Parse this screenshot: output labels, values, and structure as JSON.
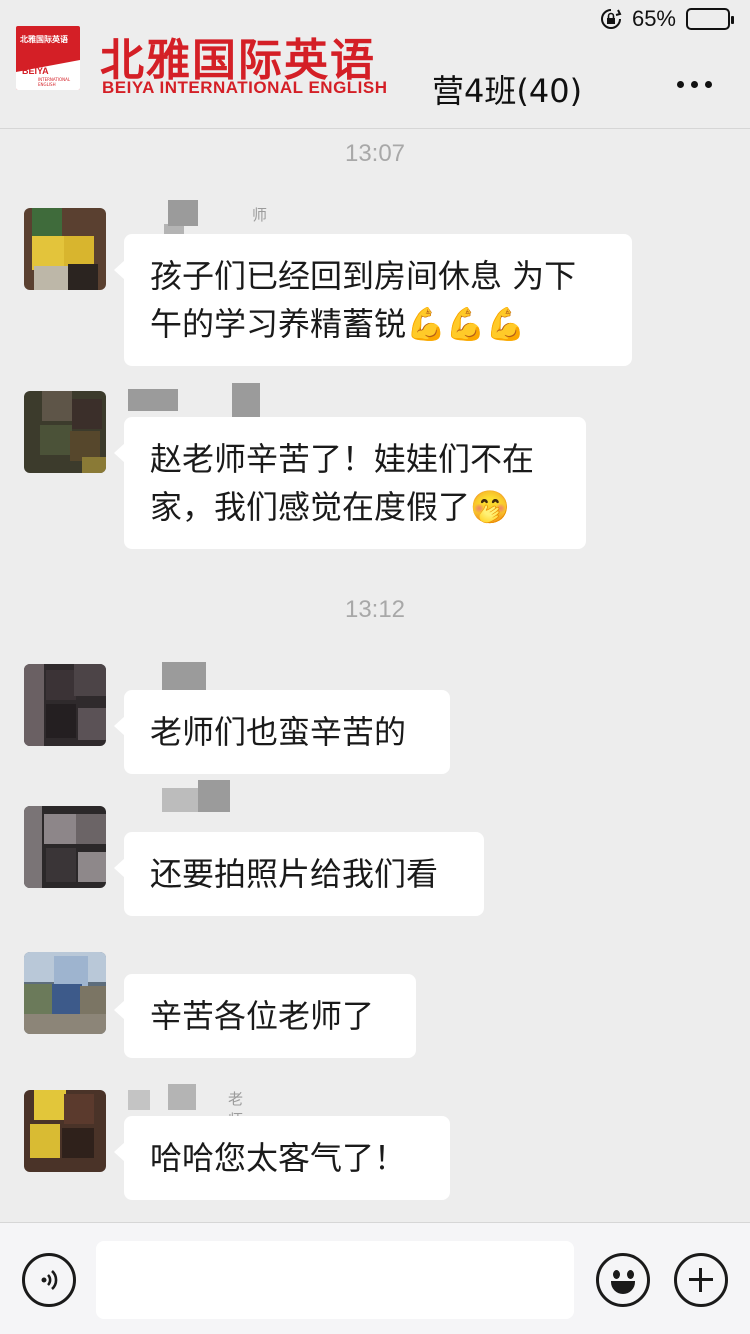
{
  "status_bar": {
    "battery_percent_label": "65%",
    "battery_level": 0.65,
    "icons": [
      "orientation-lock-icon",
      "battery-icon"
    ]
  },
  "header": {
    "logo": {
      "small_cn": "北雅国际英语",
      "beiya": "BEIYA",
      "tiny": "INTERNATIONAL ENGLISH"
    },
    "brand_cn": "北雅国际英语",
    "brand_en": "BEIYA  INTERNATIONAL ENGLISH",
    "chat_title": "营4班(40)",
    "more_icon": "more-dots-icon"
  },
  "timestamps": [
    "13:07",
    "13:12"
  ],
  "messages": [
    {
      "sender_fragment": "师",
      "text_lines": [
        "孩子们已经回到房间休息 为下",
        "午的学习养精蓄锐💪💪💪"
      ]
    },
    {
      "sender_fragment": "",
      "text_lines": [
        "赵老师辛苦了！娃娃们不在",
        "家，我们感觉在度假了🤭"
      ]
    },
    {
      "sender_fragment": "",
      "text_lines": [
        "老师们也蛮辛苦的"
      ]
    },
    {
      "sender_fragment": "",
      "text_lines": [
        "还要拍照片给我们看"
      ]
    },
    {
      "sender_fragment": "",
      "text_lines": [
        "辛苦各位老师了"
      ]
    },
    {
      "sender_fragment": "老师",
      "text_lines": [
        "哈哈您太客气了！"
      ]
    }
  ],
  "input_bar": {
    "placeholder": "",
    "voice_icon": "voice-icon",
    "emoji_icon": "emoji-icon",
    "plus_icon": "plus-icon"
  },
  "colors": {
    "brand_red": "#d41f26",
    "chat_background": "#ededed",
    "bubble": "#ffffff",
    "timestamp": "#a8a8a8"
  }
}
